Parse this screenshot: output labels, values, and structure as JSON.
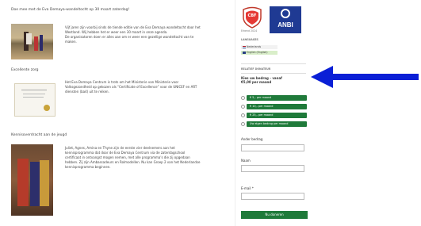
{
  "left": {
    "intro_heading": "Doe mee met de Eva Demaya-wandeltocht op 30 maart zaterdag!",
    "section1": {
      "lines": [
        "Vijf jaren zijn voorbij sinds de tiende editie van de Eva Demaya wandeltocht door het",
        "Westland. Wij hebben het er weer een 30 maart in onze agenda.",
        "De organisatoren doen er alles aan om er weer een gezellige wandeltocht van te",
        "maken."
      ]
    },
    "section2_title": "Excellente zorg",
    "section2": {
      "lines": [
        "Het Eva Demaya Centrum is trots om het Ministerie van Ministerie voor",
        "Volksgezondheid op gekozen als “Certificate of Excellence” voor de UNICEF en ART",
        "diensten (ba4) uit te reiken."
      ]
    },
    "section3_title": "Kennisoverdracht aan de jeugd",
    "section3": {
      "lines": [
        "Juliet, Agnes, Amina en Thyne zijn de eerste vier deelnemers aan het",
        "kennisprogramma dat door de Eva Demaya Centrum via de zaterdagschool",
        "certificaat in ontvangst mogen nemen, met alle programma's die zij opgedaan",
        "hebben. Zij zijn Ambassadeurs en Rolmodellen. Nu kan Groep 2 van het Nederlandse",
        "kennisprogramma beginnen."
      ]
    }
  },
  "sidebar": {
    "cbf_label": "CBF",
    "cbf_sub": "Erkend Goed Doel",
    "anbi_label": "ANBI",
    "cbf_caption": "Erkend 2024",
    "languages_title": "LANGUAGES",
    "languages": [
      "Nederlands",
      "English (English)"
    ],
    "donate_title": "RELATIEF DONATEUR",
    "donate_question": "Kies uw bedrag - vanaf",
    "donate_question2": "€5,00 per maand",
    "amount_options": [
      "€ 5,- per maand",
      "€ 10,- per maand",
      "€ 25,- per maand",
      "Uw eigen bedrag per maand"
    ],
    "other_amount_label": "Ander bedrag",
    "name_label": "Naam",
    "email_label": "E-mail *",
    "submit_label": "Nu doneren",
    "colors": {
      "green": "#1f7a3a",
      "arrow": "#0a1fd6"
    }
  }
}
